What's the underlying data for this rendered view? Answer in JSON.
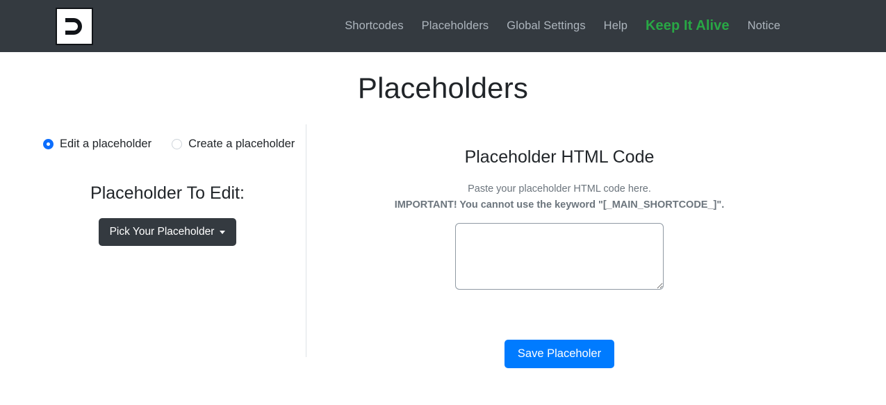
{
  "navbar": {
    "brand_icon": "reverse-d-logo",
    "links": [
      {
        "label": "Shortcodes",
        "accent": false
      },
      {
        "label": "Placeholders",
        "accent": false
      },
      {
        "label": "Global Settings",
        "accent": false
      },
      {
        "label": "Help",
        "accent": false
      },
      {
        "label": "Keep It Alive",
        "accent": true
      },
      {
        "label": "Notice",
        "accent": false
      }
    ],
    "accent_color": "#28a745",
    "background_color": "#343a40"
  },
  "page": {
    "title": "Placeholders"
  },
  "mode_selector": {
    "options": [
      {
        "label": "Edit a placeholder",
        "selected": true
      },
      {
        "label": "Create a placeholder",
        "selected": false
      }
    ],
    "selected_color": "#0d6efd"
  },
  "left_panel": {
    "heading": "Placeholder To Edit:",
    "dropdown_label": "Pick Your Placeholder",
    "dropdown_icon": "caret-down-icon"
  },
  "right_panel": {
    "heading": "Placeholder HTML Code",
    "helper_text": "Paste your placeholder HTML code here.",
    "helper_important": "IMPORTANT! You cannot use the keyword \"[_MAIN_SHORTCODE_]\".",
    "textarea_value": "",
    "textarea_placeholder": "",
    "save_label": "Save Placeholer",
    "save_color": "#007bff"
  }
}
